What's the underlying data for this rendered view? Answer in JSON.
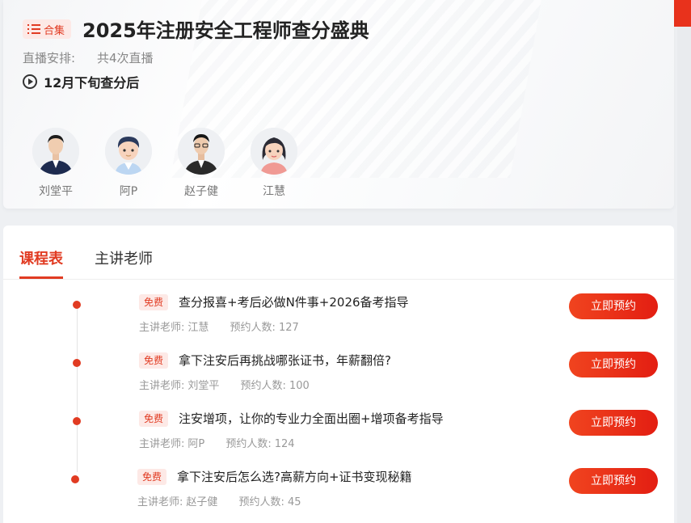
{
  "header": {
    "badge_label": "合集",
    "title": "2025年注册安全工程师查分盛典",
    "schedule_label": "直播安排:",
    "schedule_value": "共4次直播",
    "time_text": "12月下旬查分后"
  },
  "teachers": [
    {
      "name": "刘堂平",
      "icon": "male-teacher-suit-avatar"
    },
    {
      "name": "阿P",
      "icon": "male-cartoon-avatar"
    },
    {
      "name": "赵子健",
      "icon": "male-teacher-glasses-avatar"
    },
    {
      "name": "江慧",
      "icon": "female-cartoon-avatar"
    }
  ],
  "tabs": [
    {
      "label": "课程表",
      "active": true
    },
    {
      "label": "主讲老师",
      "active": false
    }
  ],
  "sessions": [
    {
      "badge": "免费",
      "title": "查分报喜+考后必做N件事+2026备考指导",
      "teacher_label": "主讲老师:",
      "teacher": "江慧",
      "count_label": "预约人数:",
      "count": "127",
      "button": "立即预约"
    },
    {
      "badge": "免费",
      "title": "拿下注安后再挑战哪张证书，年薪翻倍?",
      "teacher_label": "主讲老师:",
      "teacher": "刘堂平",
      "count_label": "预约人数:",
      "count": "100",
      "button": "立即预约"
    },
    {
      "badge": "免费",
      "title": "注安增项，让你的专业力全面出圈+增项备考指导",
      "teacher_label": "主讲老师:",
      "teacher": "阿P",
      "count_label": "预约人数:",
      "count": "124",
      "button": "立即预约"
    },
    {
      "badge": "免费",
      "title": "拿下注安后怎么选?高薪方向+证书变现秘籍",
      "teacher_label": "主讲老师:",
      "teacher": "赵子健",
      "count_label": "预约人数:",
      "count": "45",
      "button": "立即预约"
    }
  ],
  "colors": {
    "accent": "#e13b22",
    "badge_bg": "#fde9e6"
  }
}
